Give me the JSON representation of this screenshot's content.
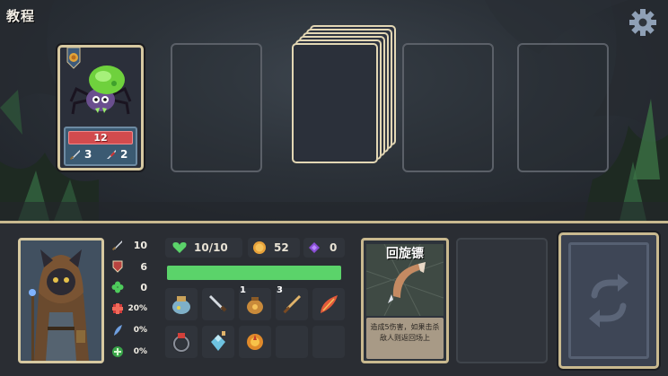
{
  "title": "教程",
  "enemy": {
    "hp": "12",
    "attack": "3",
    "attack2": "2"
  },
  "player": {
    "stats": [
      {
        "icon": "sword-icon",
        "value": "10"
      },
      {
        "icon": "shield-icon",
        "value": "6"
      },
      {
        "icon": "clover-icon",
        "value": "0"
      },
      {
        "icon": "crit-icon",
        "value": "20%"
      },
      {
        "icon": "feather-icon",
        "value": "0%"
      },
      {
        "icon": "heal-icon",
        "value": "0%"
      }
    ],
    "hp_text": "10/10",
    "hp_fraction": 1.0,
    "gold": "52",
    "gems": "0"
  },
  "inventory": [
    {
      "icon": "potion-bag-icon",
      "count": ""
    },
    {
      "icon": "dagger-icon",
      "count": ""
    },
    {
      "icon": "coin-pouch-icon",
      "count": "1"
    },
    {
      "icon": "short-sword-icon",
      "count": "3"
    },
    {
      "icon": "red-feather-icon",
      "count": ""
    },
    {
      "icon": "ring-icon",
      "count": ""
    },
    {
      "icon": "crystal-potion-icon",
      "count": ""
    },
    {
      "icon": "fire-orb-icon",
      "count": ""
    }
  ],
  "hand_card": {
    "title": "回旋镖",
    "description": "造成5伤害，如果击杀敌人则返回场上"
  },
  "colors": {
    "hp_green": "#5bd36a",
    "enemy_hp_red": "#d24b4e",
    "card_border": "#d7c9a1"
  }
}
